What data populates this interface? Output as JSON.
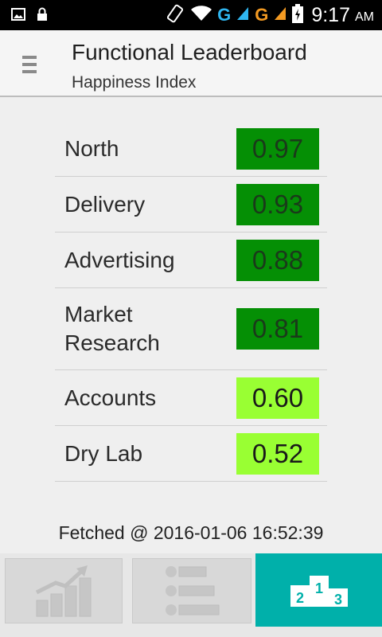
{
  "status_bar": {
    "network_1": "G",
    "network_2": "G",
    "time": "9:17",
    "ampm": "AM"
  },
  "header": {
    "title": "Functional Leaderboard",
    "subtitle": "Happiness Index"
  },
  "leaderboard": [
    {
      "name": "North",
      "score": "0.97"
    },
    {
      "name": "Delivery",
      "score": "0.93"
    },
    {
      "name": "Advertising",
      "score": "0.88"
    },
    {
      "name": "Market Research",
      "score": "0.81"
    },
    {
      "name": "Accounts",
      "score": "0.60"
    },
    {
      "name": "Dry Lab",
      "score": "0.52"
    }
  ],
  "footer": {
    "fetched": "Fetched @ 2016-01-06 16:52:39"
  },
  "bottom_nav": {
    "items": [
      {
        "icon": "trend-chart-icon",
        "active": false
      },
      {
        "icon": "bar-list-icon",
        "active": false
      },
      {
        "icon": "podium-icon",
        "active": true,
        "podium_labels": [
          "2",
          "1",
          "3"
        ]
      }
    ]
  },
  "colors": {
    "high_score": "#058f05",
    "mid_score": "#99ff33",
    "accent": "#00b0aa"
  }
}
